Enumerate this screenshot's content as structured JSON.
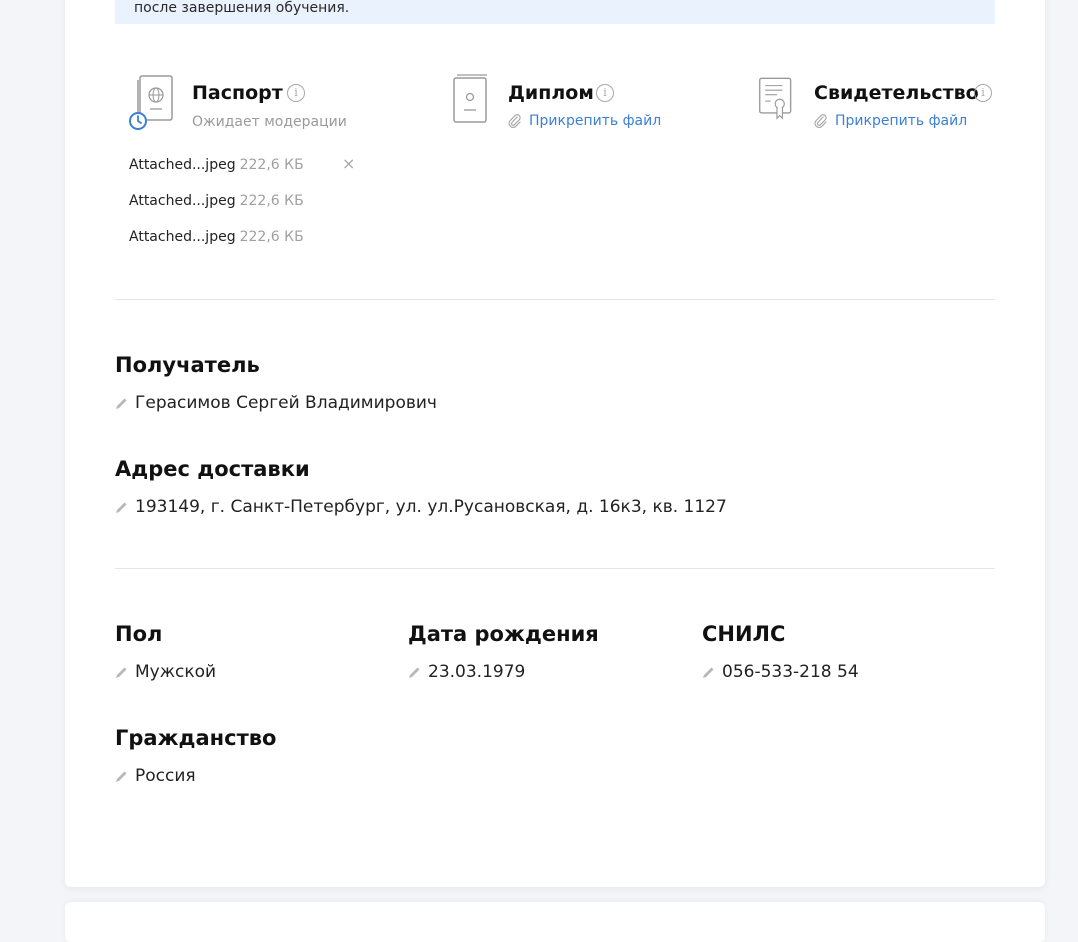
{
  "notice": {
    "text": "после завершения обучения."
  },
  "documents": [
    {
      "title": "Паспорт",
      "icon": "passport-icon",
      "status": "Ожидает модерации",
      "files": [
        {
          "name": "Attached...jpeg",
          "size": "222,6 КБ"
        },
        {
          "name": "Attached...jpeg",
          "size": "222,6 КБ"
        },
        {
          "name": "Attached...jpeg",
          "size": "222,6 КБ"
        }
      ],
      "remove_symbol": "×"
    },
    {
      "title": "Диплом",
      "icon": "diploma-icon",
      "attach_label": "Прикрепить файл"
    },
    {
      "title": "Свидетельство",
      "icon": "certificate-icon",
      "attach_label": "Прикрепить файл"
    }
  ],
  "recipient": {
    "label": "Получатель",
    "value": "Герасимов Сергей Владимирович"
  },
  "address": {
    "label": "Адрес доставки",
    "value": "193149, г. Санкт-Петербург, ул. ул.Русановская, д. 16к3, кв. 1127"
  },
  "personal": {
    "gender": {
      "label": "Пол",
      "value": "Мужской"
    },
    "birthdate": {
      "label": "Дата рождения",
      "value": "23.03.1979"
    },
    "snils": {
      "label": "СНИЛС",
      "value": "056-533-218 54"
    },
    "citizenship": {
      "label": "Гражданство",
      "value": "Россия"
    }
  },
  "colors": {
    "accent": "#3b7fd6",
    "notice_bg": "#eaf2fe",
    "muted": "#9a9a9a"
  }
}
